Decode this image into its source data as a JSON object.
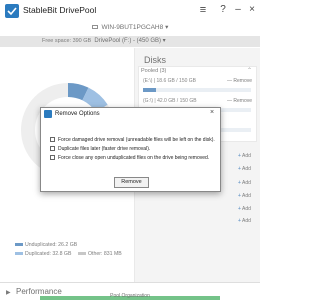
{
  "app": {
    "title": "StableBit DrivePool",
    "menu_icon": "menu-lines-icon",
    "help_icon": "question-icon",
    "minimize_icon": "minus-icon",
    "close_icon": "x-icon"
  },
  "machine": {
    "name": "WIN-9BUT1PGCAH8",
    "chevron": "▾"
  },
  "pool": {
    "label": "DrivePool (F:) - (450 GB)",
    "chevron": "▾"
  },
  "left": {
    "free_space": "Free space: 390 GB",
    "legend": {
      "unduplicated": "Unduplicated: 26.2 GB",
      "duplicated": "Duplicated: 32.8 GB",
      "other": "Other: 831 MB"
    }
  },
  "disks": {
    "title": "Disks",
    "pooled_header": "Pooled (3)",
    "pooled_chevron": "⌃",
    "disk1_label": "(E:\\) | 18.6 GB / 150 GB",
    "disk2_label": "(G:\\) | 42.0 GB / 150 GB",
    "remove_label": "— Remove",
    "add_label": "Add",
    "add_symbol": "+",
    "disk1_fill": 0.12,
    "disk2_fill": 0.28,
    "disk3_fill": 0.1
  },
  "dialog": {
    "title": "Remove Options",
    "close": "×",
    "option1": "Force damaged drive removal (unreadable files will be left on the disk).",
    "option2": "Duplicate files later (faster drive removal).",
    "option3": "Force close any open unduplicated files on the drive being removed.",
    "button": "Remove"
  },
  "performance": {
    "arrow": "▶",
    "title": "Performance"
  },
  "status": {
    "text": "Pool Organization"
  },
  "colors": {
    "accent": "#1e63a8",
    "status_green": "#2aa34a"
  }
}
